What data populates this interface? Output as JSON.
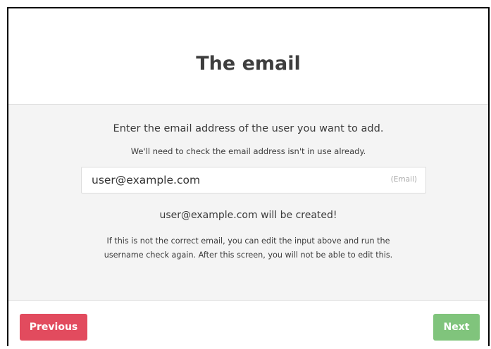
{
  "dialog": {
    "title": "The email",
    "lead": "Enter the email address of the user you want to add.",
    "sublead": "We'll need to check the email address isn't in use already.",
    "email_input": {
      "value": "user@example.com",
      "type_hint": "(Email)"
    },
    "result": "user@example.com will be created!",
    "note_line1": "If this is not the correct email, you can edit the input above and run the",
    "note_line2": "username check again. After this screen, you will not be able to edit this.",
    "buttons": {
      "previous": "Previous",
      "next": "Next"
    }
  },
  "colors": {
    "previous_button": "#e24b5e",
    "next_button": "#80c47c",
    "body_background": "#f4f4f4"
  }
}
